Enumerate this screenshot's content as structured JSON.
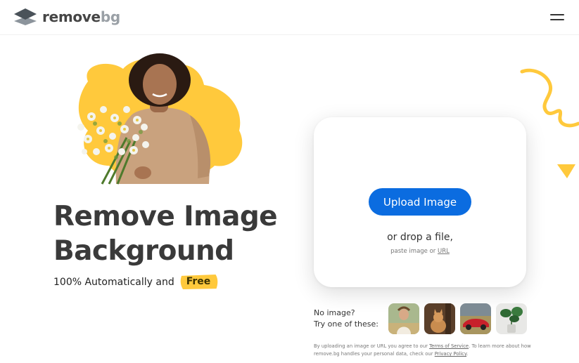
{
  "header": {
    "logo_text_main": "remove",
    "logo_text_accent": "bg",
    "logo_icon": "stacked-layers-icon",
    "menu_icon": "hamburger-menu-icon"
  },
  "hero": {
    "headline": "Remove Image Background",
    "subline_prefix": "100% Automatically and",
    "free_badge": "Free",
    "photo": "woman-holding-flowers"
  },
  "upload": {
    "button_label": "Upload Image",
    "drop_text": "or drop a file,",
    "paste_prefix": "paste image or",
    "paste_link": "URL"
  },
  "samples": {
    "line1": "No image?",
    "line2": "Try one of these:",
    "items": [
      "woman-in-field",
      "cat",
      "red-car",
      "potted-plant"
    ]
  },
  "terms": {
    "part1": "By uploading an image or URL you agree to our",
    "terms_link": "Terms of Service",
    "part2": ". To learn more about how remove.bg handles your personal data, check our",
    "privacy_link": "Privacy Policy",
    "part3": "."
  },
  "colors": {
    "accent_yellow": "#ffc93c",
    "button_blue": "#0b6ce0",
    "text_dark": "#3a3a3a"
  }
}
